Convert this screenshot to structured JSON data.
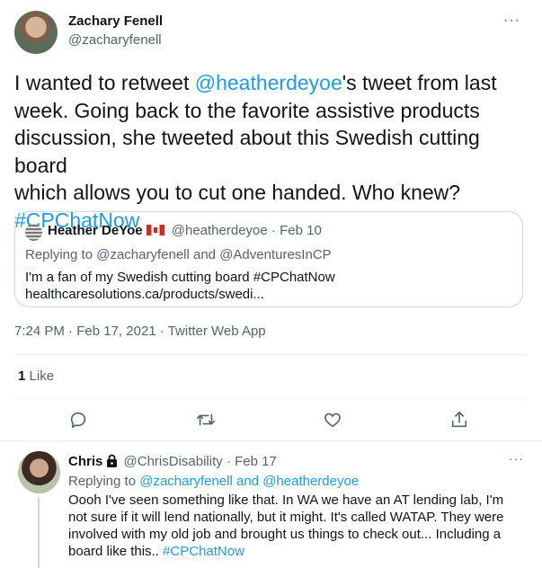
{
  "tweet": {
    "author_name": "Zachary Fenell",
    "author_handle": "@zacharyfenell",
    "more_label": "···",
    "text_prefix": "I wanted to retweet ",
    "mention": "@heatherdeyoe",
    "text_middle": "'s tweet from last\nweek. Going back to the favorite assistive products\ndiscussion, she tweeted about this Swedish cutting board\nwhich allows you to cut one handed. Who knew?\n",
    "hashtag": "#CPChatNow",
    "time": "7:24 PM",
    "date": "Feb 17, 2021",
    "source": "Twitter Web App",
    "likes_count": "1",
    "likes_label": "Like"
  },
  "quote": {
    "name": "Heather DeYoe",
    "handle": "@heatherdeyoe",
    "date": "Feb 10",
    "replying_to_label": "Replying to",
    "reply_mention_1": "@zacharyfenell",
    "reply_and": "and",
    "reply_mention_2": "@AdventuresInCP",
    "text": "I'm a fan of my Swedish cutting board #CPChatNow\nhealthcaresolutions.ca/products/swedi..."
  },
  "reply": {
    "name": "Chris",
    "handle": "@ChrisDisability",
    "date": "Feb 17",
    "replying_to_label": "Replying to",
    "reply_mention_1": "@zacharyfenell",
    "reply_and": "and",
    "reply_mention_2": "@heatherdeyoe",
    "text": "Oooh I've seen something like that. In WA we have an AT lending lab, I'm\nnot sure if it will lend nationally, but it might. It's called WATAP. They were\ninvolved with my old job and brought us things to check out... Including a\nboard like this.. ",
    "hashtag": "#CPChatNow",
    "more_label": "···"
  },
  "colors": {
    "accent": "#1d9bf0",
    "muted": "#536471",
    "border": "#cfd9de"
  },
  "icons": [
    "reply-icon",
    "retweet-icon",
    "like-icon",
    "share-icon",
    "lock-icon",
    "canada-flag-icon"
  ]
}
